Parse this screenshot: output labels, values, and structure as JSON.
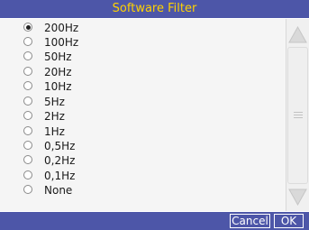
{
  "dialog": {
    "title": "Software Filter",
    "options": [
      {
        "label": "200Hz",
        "selected": true
      },
      {
        "label": "100Hz",
        "selected": false
      },
      {
        "label": "50Hz",
        "selected": false
      },
      {
        "label": "20Hz",
        "selected": false
      },
      {
        "label": "10Hz",
        "selected": false
      },
      {
        "label": "5Hz",
        "selected": false
      },
      {
        "label": "2Hz",
        "selected": false
      },
      {
        "label": "1Hz",
        "selected": false
      },
      {
        "label": "0,5Hz",
        "selected": false
      },
      {
        "label": "0,2Hz",
        "selected": false
      },
      {
        "label": "0,1Hz",
        "selected": false
      },
      {
        "label": "None",
        "selected": false
      }
    ],
    "buttons": {
      "cancel_label": "Cancel",
      "ok_label": "OK"
    },
    "scrollbar": {
      "up_icon": "triangle-up-icon",
      "down_icon": "triangle-down-icon",
      "grip_icon": "grip-lines-icon"
    },
    "colors": {
      "title_bar": "#4d56a8",
      "title_text": "#ffd200",
      "list_background": "#f5f5f5",
      "button_text": "#ffffff"
    }
  }
}
